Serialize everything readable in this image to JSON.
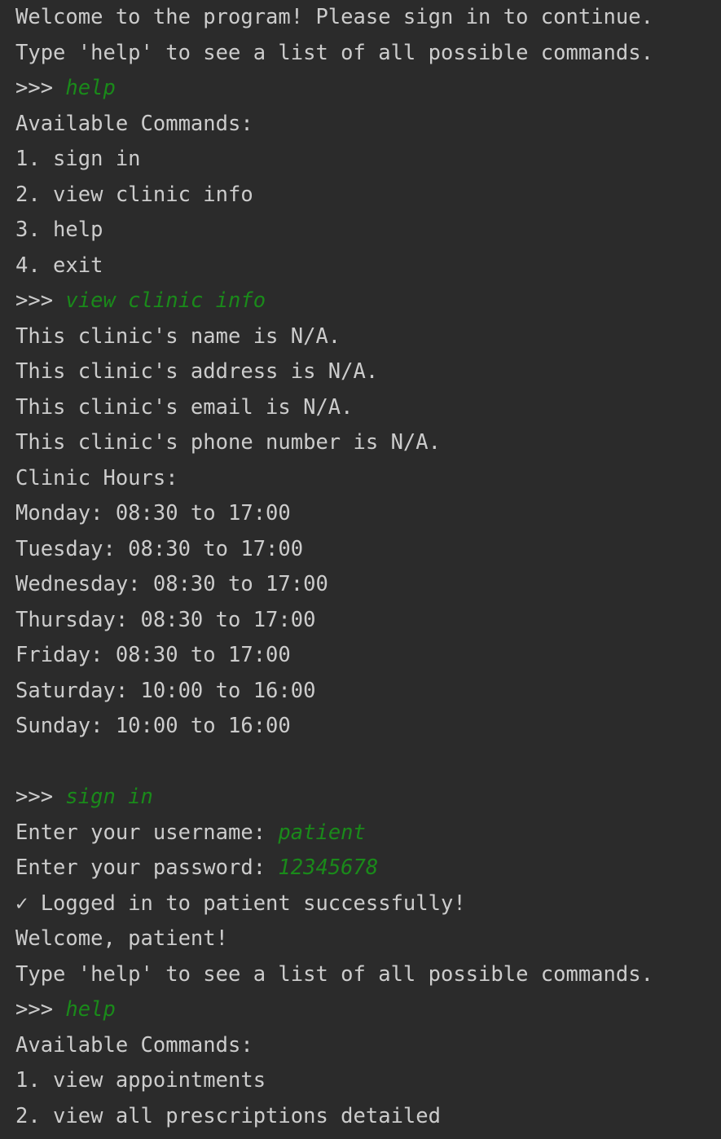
{
  "lines": [
    {
      "text": "Welcome to the program! Please sign in to continue."
    },
    {
      "text": "Type 'help' to see a list of all possible commands."
    },
    {
      "prompt": ">>> ",
      "input": "help"
    },
    {
      "text": "Available Commands:"
    },
    {
      "text": "1. sign in"
    },
    {
      "text": "2. view clinic info"
    },
    {
      "text": "3. help"
    },
    {
      "text": "4. exit"
    },
    {
      "prompt": ">>> ",
      "input": "view clinic info"
    },
    {
      "text": "This clinic's name is N/A."
    },
    {
      "text": "This clinic's address is N/A."
    },
    {
      "text": "This clinic's email is N/A."
    },
    {
      "text": "This clinic's phone number is N/A."
    },
    {
      "text": "Clinic Hours:"
    },
    {
      "text": "Monday: 08:30 to 17:00"
    },
    {
      "text": "Tuesday: 08:30 to 17:00"
    },
    {
      "text": "Wednesday: 08:30 to 17:00"
    },
    {
      "text": "Thursday: 08:30 to 17:00"
    },
    {
      "text": "Friday: 08:30 to 17:00"
    },
    {
      "text": "Saturday: 10:00 to 16:00"
    },
    {
      "text": "Sunday: 10:00 to 16:00"
    },
    {
      "text": ""
    },
    {
      "prompt": ">>> ",
      "input": "sign in"
    },
    {
      "prompt": "Enter your username: ",
      "input": "patient"
    },
    {
      "prompt": "Enter your password: ",
      "input": "12345678"
    },
    {
      "text": "✓ Logged in to patient successfully!"
    },
    {
      "text": "Welcome, patient!"
    },
    {
      "text": "Type 'help' to see a list of all possible commands."
    },
    {
      "prompt": ">>> ",
      "input": "help"
    },
    {
      "text": "Available Commands:"
    },
    {
      "text": "1. view appointments"
    },
    {
      "text": "2. view all prescriptions detailed"
    }
  ],
  "colors": {
    "background": "#2b2b2b",
    "output_text": "#cccccc",
    "user_input": "#1a8a1a"
  }
}
